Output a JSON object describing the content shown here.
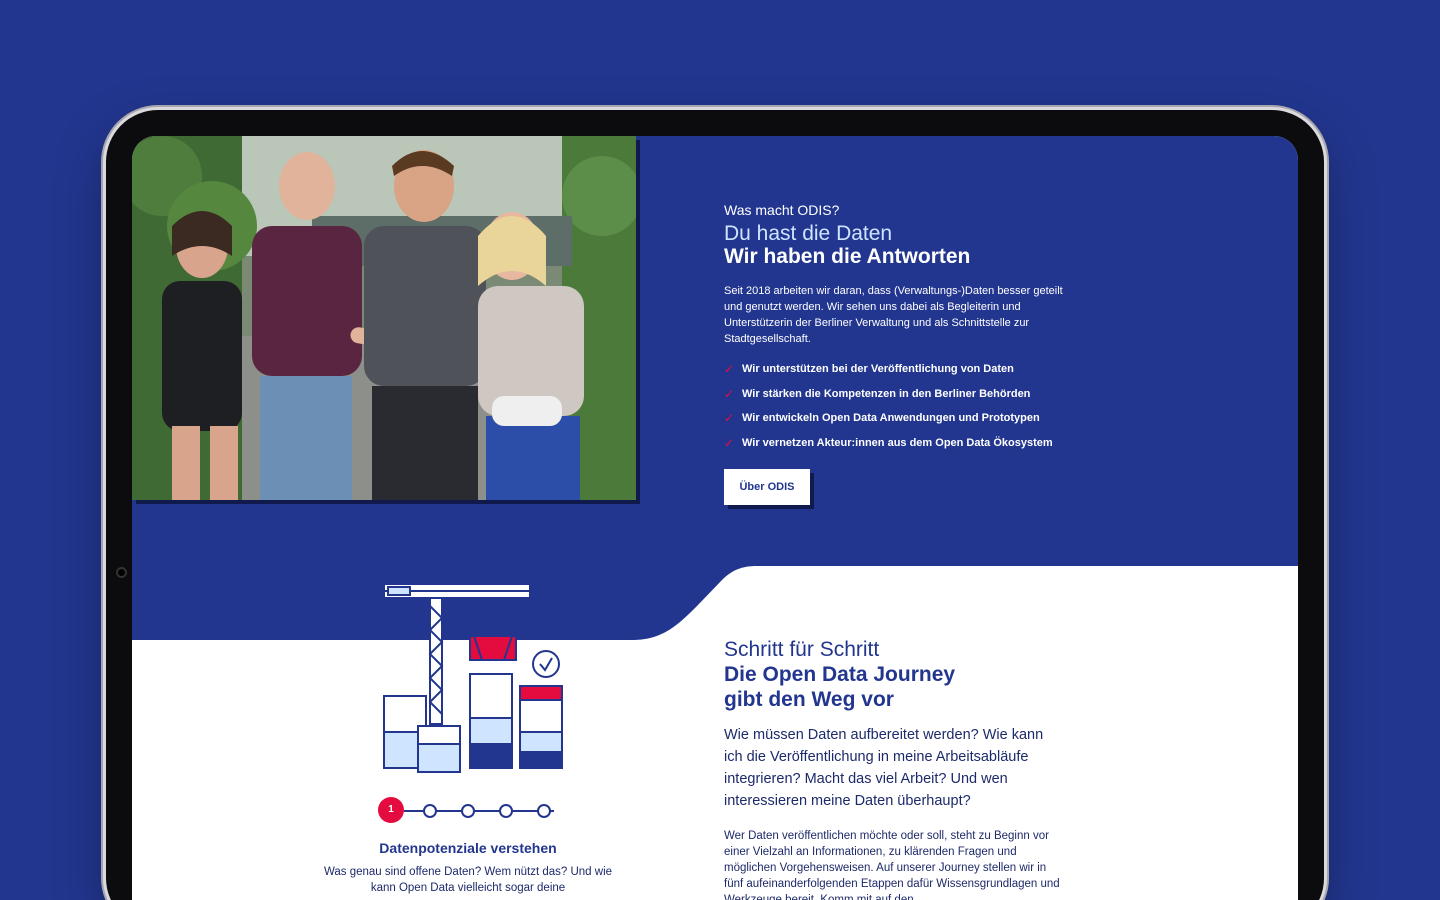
{
  "colors": {
    "background": "#22368f",
    "accent": "#e40c3e",
    "light_blue": "#cfe4ff"
  },
  "hero": {
    "eyebrow": "Was macht ODIS?",
    "headline_line1": "Du hast die Daten",
    "headline_line2": "Wir haben die Antworten",
    "intro": "Seit 2018 arbeiten wir daran, dass (Verwaltungs-)Daten besser geteilt und genutzt werden. Wir sehen uns dabei als Begleiterin und Unterstützerin der Berliner Verwaltung und als Schnittstelle zur Stadtgesellschaft.",
    "checklist": [
      "Wir unterstützen bei der Veröffentlichung von Daten",
      "Wir stärken die Kompetenzen in den Berliner Behörden",
      "Wir entwickeln Open Data Anwendungen und Prototypen",
      "Wir vernetzen Akteur:innen aus dem Open Data Ökosystem"
    ],
    "check_icon": "✓",
    "button_label": "Über ODIS"
  },
  "journey": {
    "eyebrow": "Schritt für Schritt",
    "title_line1": "Die Open Data Journey",
    "title_line2": "gibt den Weg vor",
    "lead": "Wie müssen Daten aufbereitet werden? Wie kann ich die Veröffentlichung in meine Arbeitsabläufe integrieren? Macht das viel Arbeit? Und wen interessieren meine Daten überhaupt?",
    "body": "Wer Daten veröffentlichen möchte oder soll, steht zu Beginn vor einer Vielzahl an Informationen, zu klärenden Fragen und möglichen Vorgehensweisen. Auf unserer Journey stellen wir in fünf aufeinanderfolgenden Etappen dafür Wissensgrundlagen und Werkzeuge bereit. Komm mit auf den"
  },
  "stepper": {
    "active_step": "1",
    "title": "Datenpotenziale verstehen",
    "description": "Was genau sind offene Daten? Wem nützt das? Und wie kann Open Data vielleicht sogar deine"
  }
}
